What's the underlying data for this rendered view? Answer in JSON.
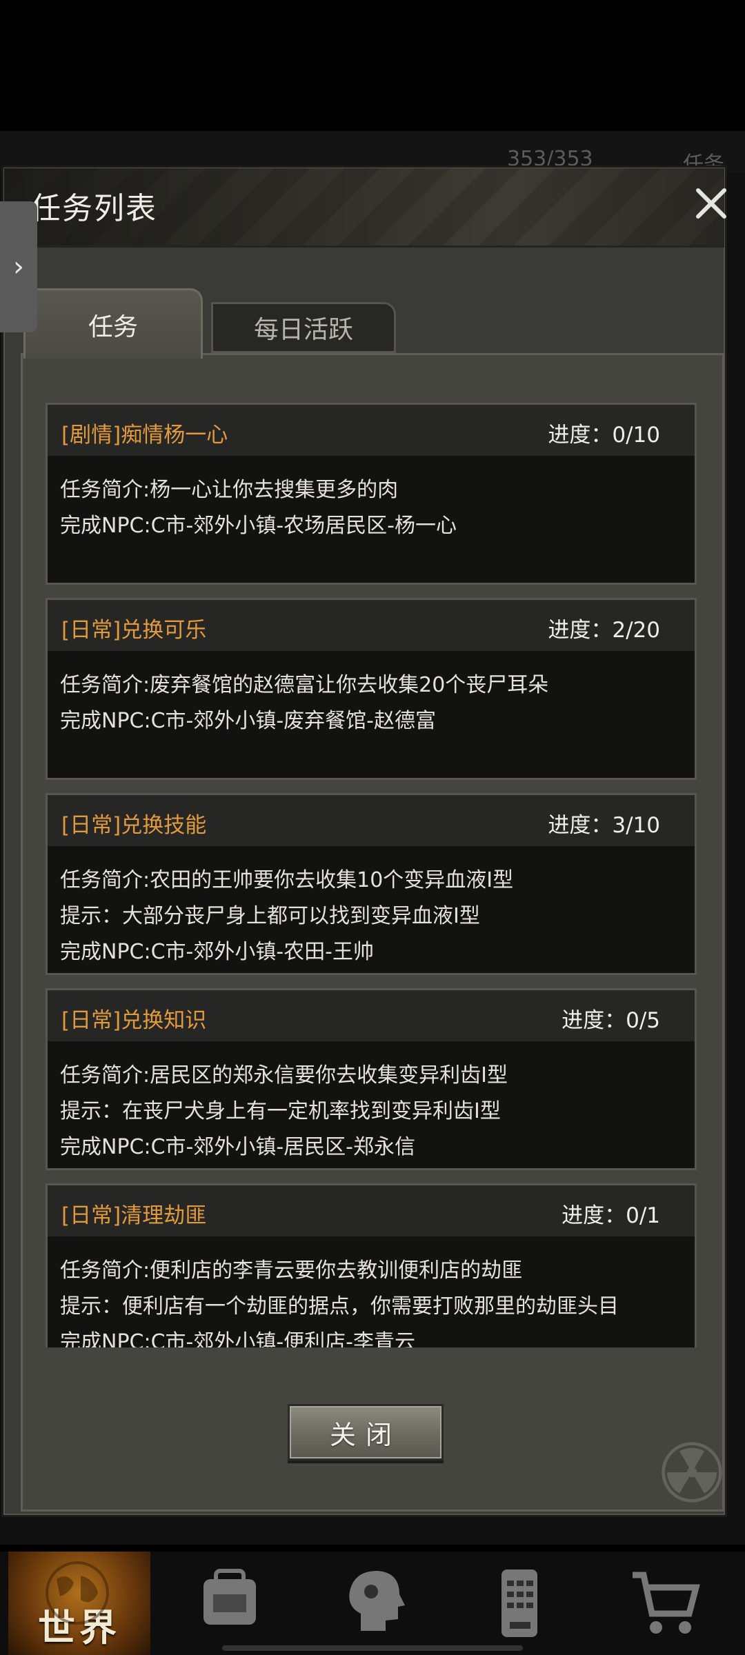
{
  "background": {
    "hp_text": "353/353",
    "top_tab_text": "任务"
  },
  "dialog": {
    "title": "任务列表",
    "tabs": [
      {
        "label": "任务",
        "active": true
      },
      {
        "label": "每日活跃",
        "active": false
      }
    ],
    "progress_label": "进度：",
    "quests": [
      {
        "title": "[剧情]痴情杨一心",
        "progress": "进度：0/10",
        "lines": [
          "任务简介:杨一心让你去搜集更多的肉",
          "完成NPC:C市-郊外小镇-农场居民区-杨一心"
        ]
      },
      {
        "title": "[日常]兑换可乐",
        "progress": "进度：2/20",
        "lines": [
          "任务简介:废弃餐馆的赵德富让你去收集20个丧尸耳朵",
          "完成NPC:C市-郊外小镇-废弃餐馆-赵德富"
        ]
      },
      {
        "title": "[日常]兑换技能",
        "progress": "进度：3/10",
        "lines": [
          "任务简介:农田的王帅要你去收集10个变异血液Ⅰ型",
          "提示：大部分丧尸身上都可以找到变异血液Ⅰ型",
          "完成NPC:C市-郊外小镇-农田-王帅"
        ]
      },
      {
        "title": "[日常]兑换知识",
        "progress": "进度：0/5",
        "lines": [
          "任务简介:居民区的郑永信要你去收集变异利齿Ⅰ型",
          "提示：在丧尸犬身上有一定机率找到变异利齿Ⅰ型",
          "完成NPC:C市-郊外小镇-居民区-郑永信"
        ]
      },
      {
        "title": "[日常]清理劫匪",
        "progress": "进度：0/1",
        "lines": [
          "任务简介:便利店的李青云要你去教训便利店的劫匪",
          "提示：便利店有一个劫匪的据点，你需要打败那里的劫匪头目",
          "完成NPC:C市-郊外小镇-便利店-李青云"
        ]
      }
    ],
    "close_button": "关闭"
  },
  "bottom_nav": {
    "items": [
      {
        "label": "世界",
        "icon": "globe-icon",
        "active": true
      },
      {
        "label": "",
        "icon": "backpack-icon"
      },
      {
        "label": "",
        "icon": "head-icon"
      },
      {
        "label": "",
        "icon": "phone-icon"
      },
      {
        "label": "",
        "icon": "cart-icon"
      }
    ]
  },
  "colors": {
    "quest_title": "#e29a3f",
    "card_bg": "#121210",
    "panel_bg": "#454540"
  }
}
